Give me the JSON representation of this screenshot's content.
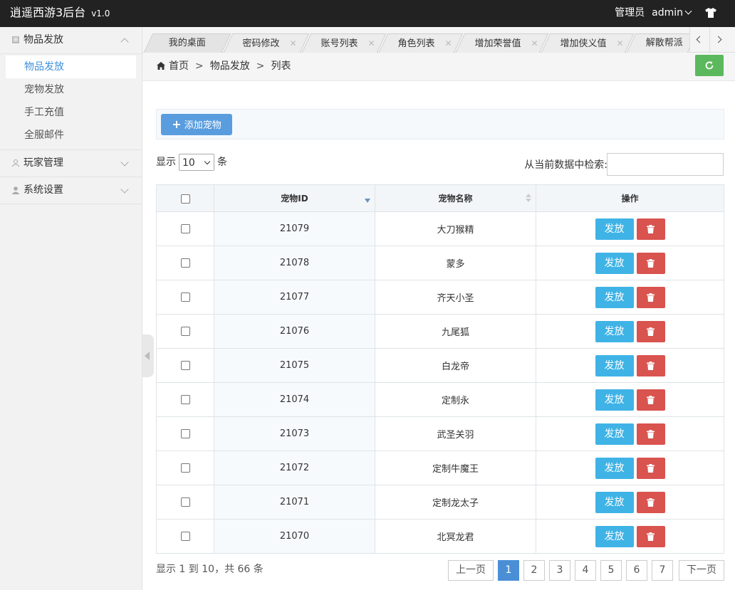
{
  "header": {
    "title": "逍遥西游3后台",
    "version": "v1.0",
    "role": "管理员",
    "username": "admin"
  },
  "sidebar": {
    "groups": [
      {
        "label": "物品发放",
        "items": [
          "物品发放",
          "宠物发放",
          "手工充值",
          "全服邮件"
        ],
        "active": "物品发放"
      },
      {
        "label": "玩家管理"
      },
      {
        "label": "系统设置"
      }
    ]
  },
  "tabs": [
    {
      "label": "我的桌面",
      "closable": false
    },
    {
      "label": "密码修改",
      "closable": true
    },
    {
      "label": "账号列表",
      "closable": true
    },
    {
      "label": "角色列表",
      "closable": true
    },
    {
      "label": "增加荣誉值",
      "closable": true
    },
    {
      "label": "增加侠义值",
      "closable": true
    },
    {
      "label": "解散帮派",
      "closable": false
    }
  ],
  "breadcrumb": {
    "home": "首页",
    "sep": ">",
    "level1": "物品发放",
    "level2": "列表"
  },
  "toolbar": {
    "add_label": "添加宠物"
  },
  "length": {
    "prefix": "显示",
    "value": "10",
    "suffix": "条"
  },
  "search": {
    "label": "从当前数据中检索:",
    "value": ""
  },
  "table": {
    "headers": {
      "id": "宠物ID",
      "name": "宠物名称",
      "ops": "操作"
    },
    "send_label": "发放",
    "rows": [
      {
        "id": "21079",
        "name": "大刀猴精"
      },
      {
        "id": "21078",
        "name": "蒙多"
      },
      {
        "id": "21077",
        "name": "齐天小圣"
      },
      {
        "id": "21076",
        "name": "九尾狐"
      },
      {
        "id": "21075",
        "name": "白龙帝"
      },
      {
        "id": "21074",
        "name": "定制永"
      },
      {
        "id": "21073",
        "name": "武圣关羽"
      },
      {
        "id": "21072",
        "name": "定制牛魔王"
      },
      {
        "id": "21071",
        "name": "定制龙太子"
      },
      {
        "id": "21070",
        "name": "北冥龙君"
      }
    ]
  },
  "footer": {
    "info": "显示 1 到 10，共 66 条",
    "prev": "上一页",
    "next": "下一页",
    "pages": [
      "1",
      "2",
      "3",
      "4",
      "5",
      "6",
      "7"
    ],
    "current": "1"
  },
  "colors": {
    "topbar": "#222222",
    "accent": "#3f8fdb",
    "send": "#3fb3e6",
    "delete": "#d9534f",
    "refresh": "#5cb85c"
  }
}
